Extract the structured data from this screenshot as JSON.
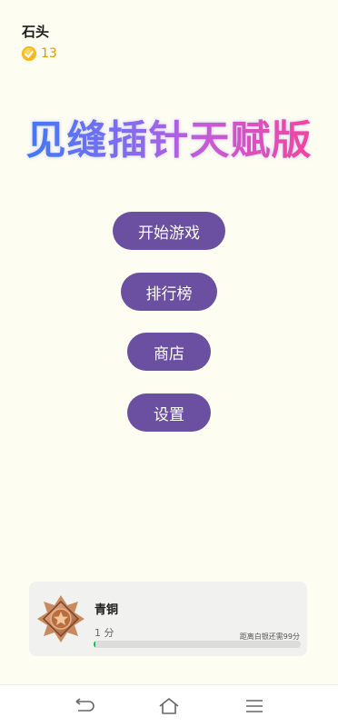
{
  "player": {
    "name": "石头",
    "coins": "13"
  },
  "title": "见缝插针天赋版",
  "menu": {
    "start": "开始游戏",
    "leaderboard": "排行榜",
    "shop": "商店",
    "settings": "设置"
  },
  "rank": {
    "name": "青铜",
    "score": "1 分",
    "next_hint": "距离白银还需99分",
    "progress": 0.01
  },
  "colors": {
    "button": "#6b4fa0",
    "progress": "#23b04a",
    "coin": "#f2a900"
  },
  "icons": {
    "coin": "coin-icon",
    "badge": "bronze-star-badge-icon",
    "back": "back-icon",
    "home": "home-icon",
    "menu": "menu-icon"
  }
}
